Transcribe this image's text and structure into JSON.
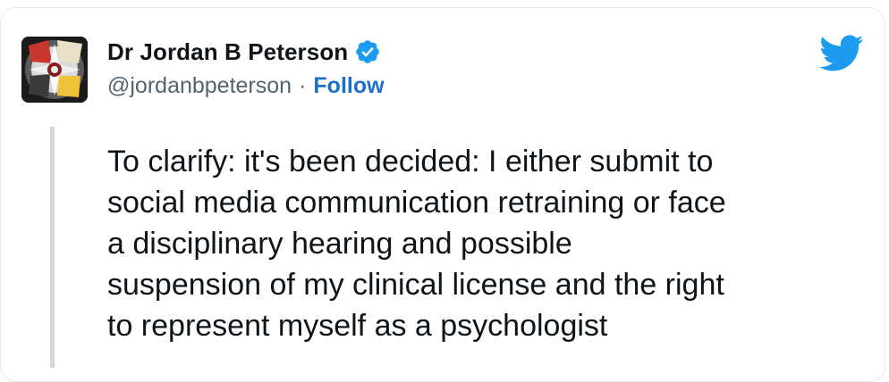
{
  "author": {
    "display_name": "Dr Jordan B Peterson",
    "handle": "@jordanbpeterson",
    "separator": "·",
    "follow_label": "Follow",
    "verified": true
  },
  "tweet": {
    "text": "To clarify: it's been decided: I either submit to\nsocial media communication retraining or face\na disciplinary hearing and possible\nsuspension of my clinical license and the right\nto represent myself as a psychologist"
  },
  "icons": {
    "brand": "twitter-bird-icon",
    "badge": "verified-badge-icon"
  },
  "colors": {
    "twitter_blue": "#1d9bf0",
    "follow_link": "#1d70c8",
    "handle_gray": "#536471",
    "text": "#0f1419",
    "quote_bar": "#cfd9de"
  }
}
